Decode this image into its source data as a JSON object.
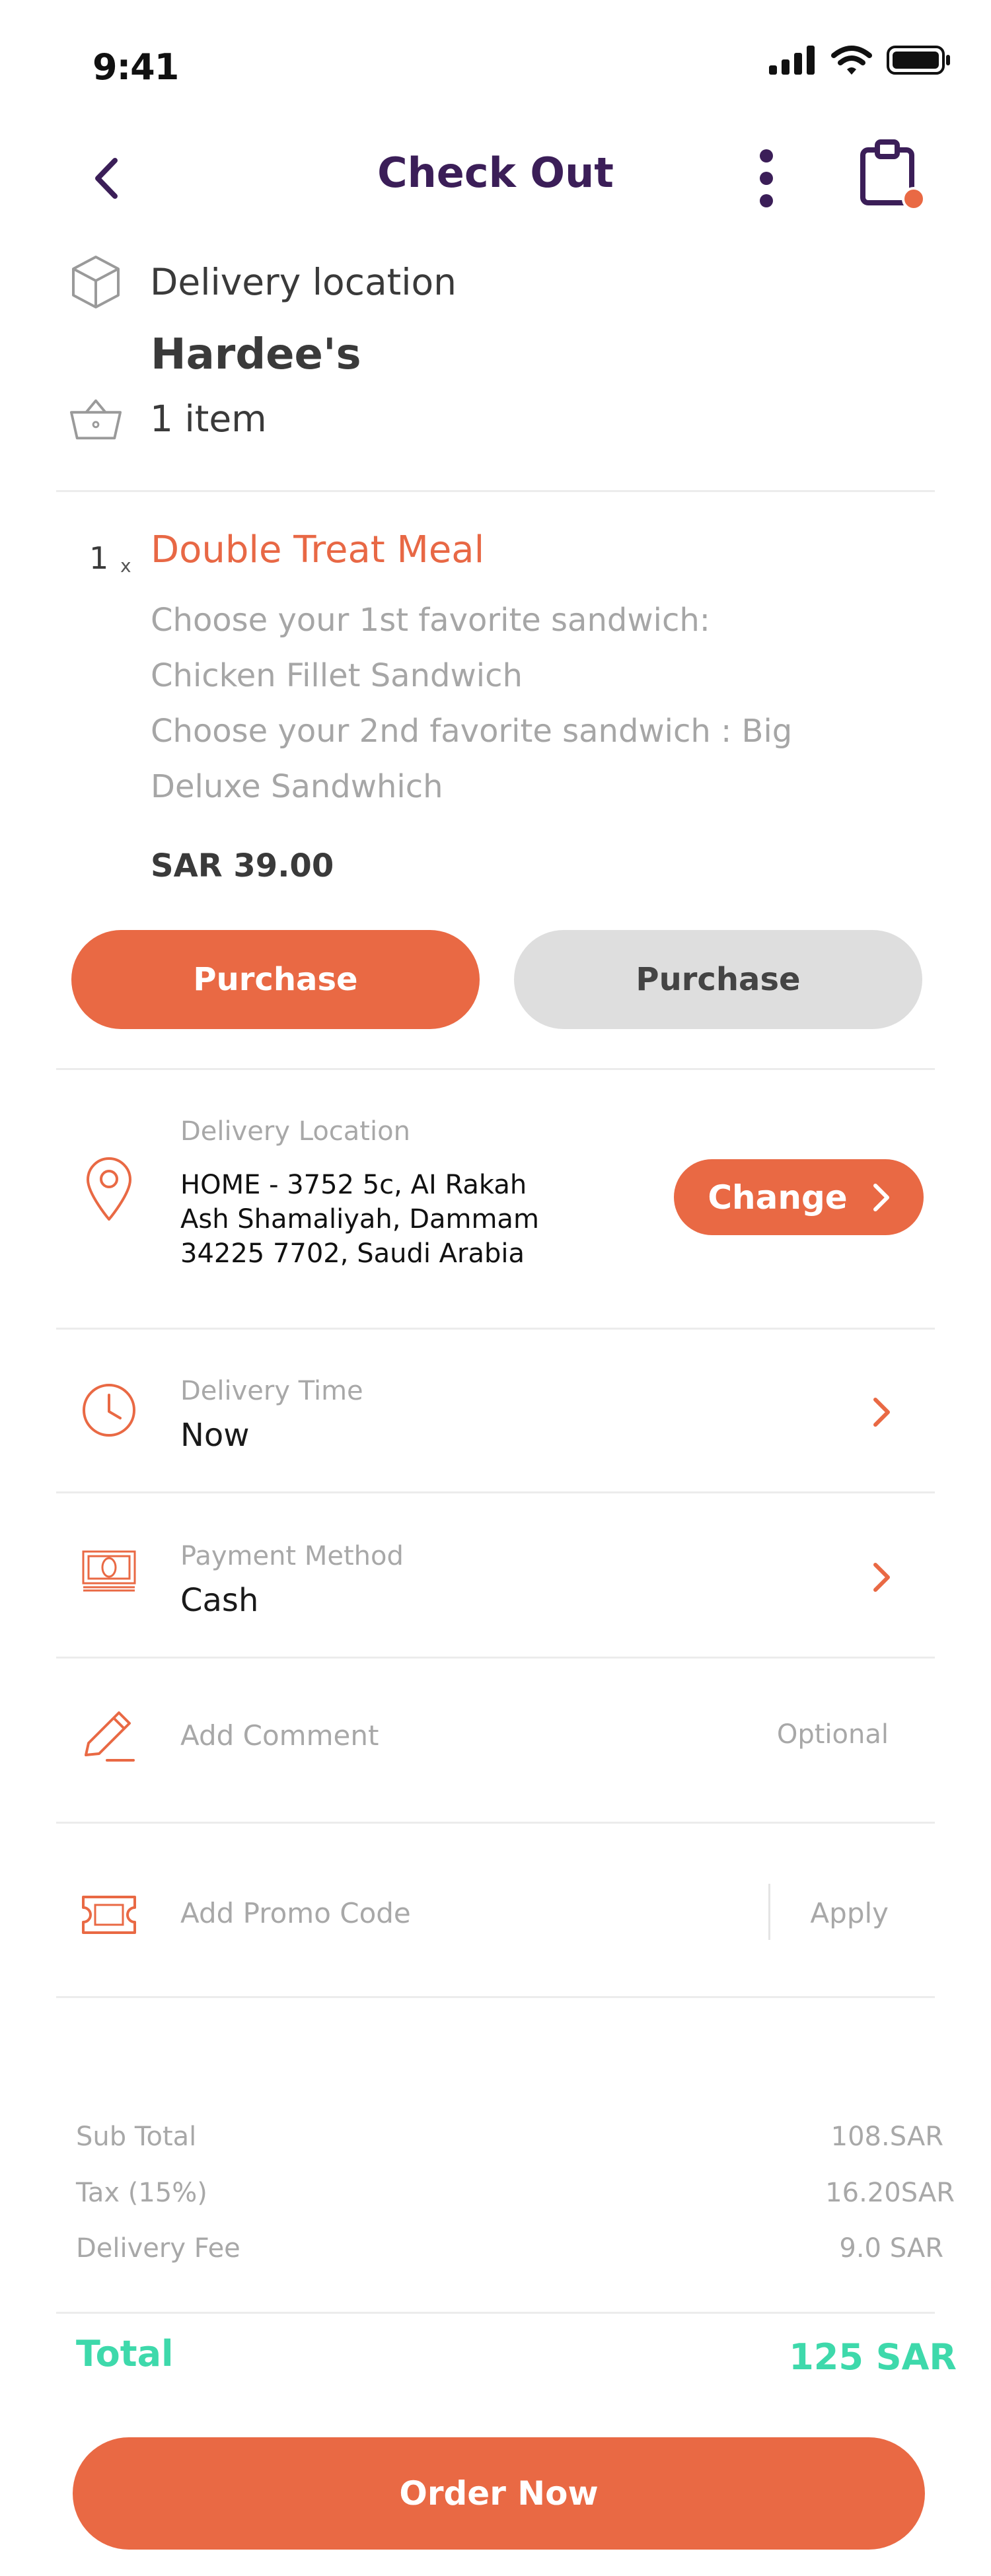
{
  "status_bar": {
    "time": "9:41"
  },
  "header": {
    "title": "Check Out"
  },
  "order_info": {
    "delivery_location_label": "Delivery location",
    "store_name": "Hardee's",
    "item_count": "1 item"
  },
  "item": {
    "quantity": "1",
    "multiplier": "x",
    "name": "Double Treat Meal",
    "desc_lines": [
      "Choose your 1st favorite sandwich:",
      "Chicken Fillet Sandwich",
      "Choose your 2nd favorite sandwich : Big",
      "Deluxe Sandwhich"
    ],
    "price": "SAR 39.00"
  },
  "actions": {
    "primary_label": "Purchase",
    "secondary_label": "Purchase"
  },
  "delivery_location": {
    "label": "Delivery Location",
    "address_lines": [
      "HOME - 3752 5c, AI Rakah",
      "Ash Shamaliyah, Dammam",
      "34225 7702, Saudi Arabia"
    ],
    "change_label": "Change"
  },
  "delivery_time": {
    "label": "Delivery Time",
    "value": "Now"
  },
  "payment_method": {
    "label": "Payment Method",
    "value": "Cash"
  },
  "comment": {
    "placeholder": "Add Comment",
    "hint": "Optional"
  },
  "promo": {
    "placeholder": "Add Promo Code",
    "apply_label": "Apply"
  },
  "summary": {
    "sub_total_label": "Sub Total",
    "sub_total_value": "108.SAR",
    "tax_label": "Tax (15%)",
    "tax_value": "16.20SAR",
    "delivery_fee_label": "Delivery Fee",
    "delivery_fee_value": "9.0 SAR",
    "total_label": "Total",
    "total_value": "125 SAR"
  },
  "order_button_label": "Order Now",
  "colors": {
    "accent": "#e96944",
    "title": "#3b1e58",
    "total": "#3ed9ab",
    "muted": "#a8a8a8"
  },
  "icons": {
    "back": "chevron-left-icon",
    "more": "more-vertical-icon",
    "cart": "shopping-bag-icon",
    "box": "box-icon",
    "basket": "basket-icon",
    "location": "map-pin-icon",
    "clock": "clock-icon",
    "cash": "cash-icon",
    "pencil": "pencil-icon",
    "ticket": "ticket-icon",
    "chevron": "chevron-right-icon"
  }
}
